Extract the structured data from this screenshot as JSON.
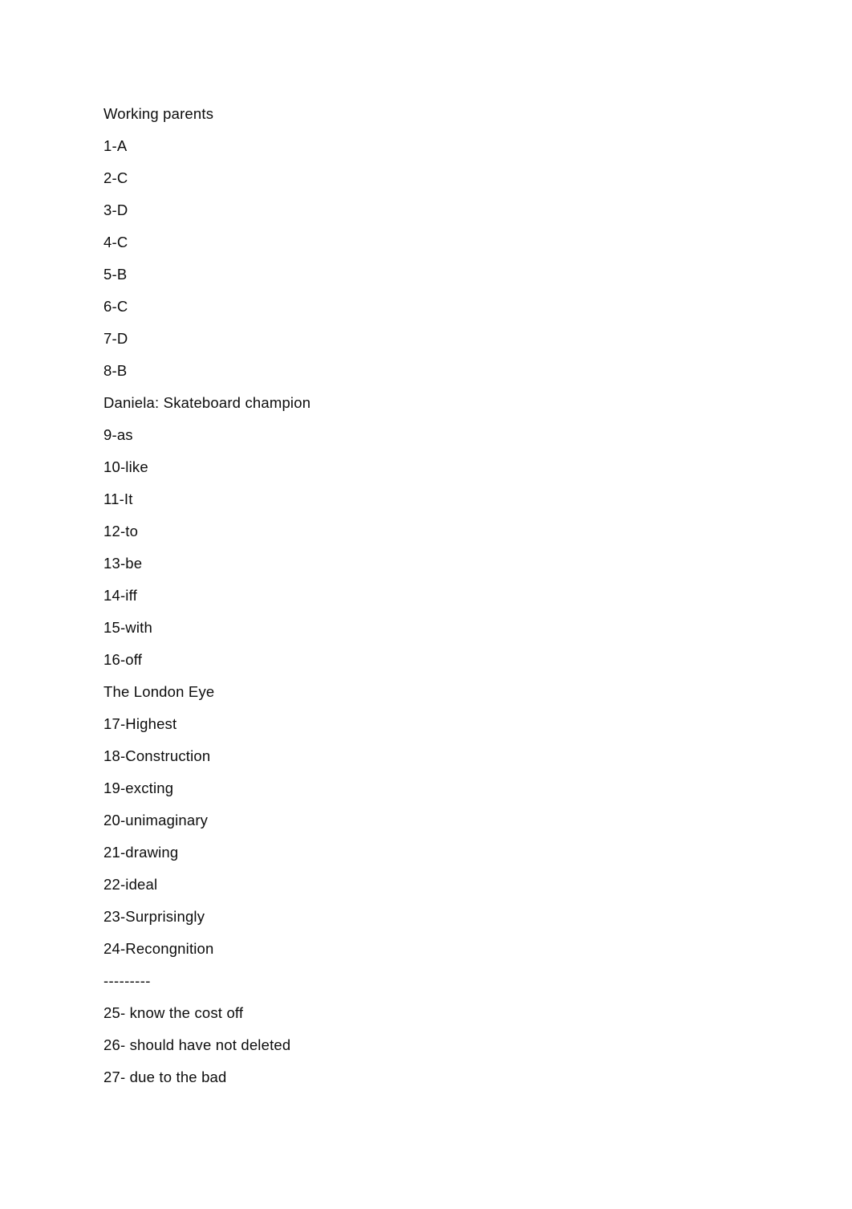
{
  "document": {
    "page_background": "#ffffff",
    "text_color": "#0D0D0D",
    "lines": [
      {
        "id": "line-1",
        "kind": "heading",
        "text": "Working parents"
      },
      {
        "id": "line-2",
        "kind": "answer",
        "text": "1-A"
      },
      {
        "id": "line-3",
        "kind": "answer",
        "text": "2-C"
      },
      {
        "id": "line-4",
        "kind": "answer",
        "text": "3-D"
      },
      {
        "id": "line-5",
        "kind": "answer",
        "text": "4-C"
      },
      {
        "id": "line-6",
        "kind": "answer",
        "text": "5-B"
      },
      {
        "id": "line-7",
        "kind": "answer",
        "text": "6-C"
      },
      {
        "id": "line-8",
        "kind": "answer",
        "text": "7-D"
      },
      {
        "id": "line-9",
        "kind": "answer",
        "text": "8-B"
      },
      {
        "id": "line-10",
        "kind": "heading",
        "text": "Daniela: Skateboard champion"
      },
      {
        "id": "line-11",
        "kind": "answer",
        "text": "9-as"
      },
      {
        "id": "line-12",
        "kind": "answer",
        "text": "10-like"
      },
      {
        "id": "line-13",
        "kind": "answer",
        "text": "11-It"
      },
      {
        "id": "line-14",
        "kind": "answer",
        "text": "12-to"
      },
      {
        "id": "line-15",
        "kind": "answer",
        "text": "13-be"
      },
      {
        "id": "line-16",
        "kind": "answer",
        "text": "14-iff"
      },
      {
        "id": "line-17",
        "kind": "answer",
        "text": "15-with"
      },
      {
        "id": "line-18",
        "kind": "answer",
        "text": "16-off"
      },
      {
        "id": "line-19",
        "kind": "heading",
        "text": "The London Eye"
      },
      {
        "id": "line-20",
        "kind": "answer",
        "text": "17-Highest"
      },
      {
        "id": "line-21",
        "kind": "answer",
        "text": "18-Construction"
      },
      {
        "id": "line-22",
        "kind": "answer",
        "text": "19-excting"
      },
      {
        "id": "line-23",
        "kind": "answer",
        "text": "20-unimaginary"
      },
      {
        "id": "line-24",
        "kind": "answer",
        "text": "21-drawing"
      },
      {
        "id": "line-25",
        "kind": "answer",
        "text": "22-ideal"
      },
      {
        "id": "line-26",
        "kind": "answer",
        "text": "23-Surprisingly"
      },
      {
        "id": "line-27",
        "kind": "answer",
        "text": "24-Recongnition"
      },
      {
        "id": "line-28",
        "kind": "separator",
        "text": "---------"
      },
      {
        "id": "line-29",
        "kind": "answer",
        "text": "25- know the cost off"
      },
      {
        "id": "line-30",
        "kind": "answer",
        "text": "26- should have not deleted"
      },
      {
        "id": "line-31",
        "kind": "answer",
        "text": "27- due to the bad"
      }
    ]
  }
}
